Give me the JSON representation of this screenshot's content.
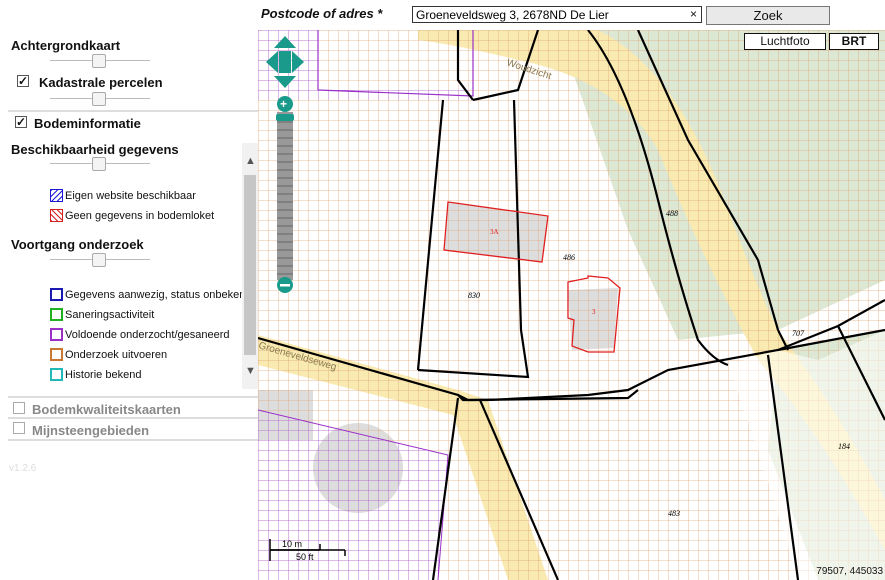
{
  "search": {
    "label": "Postcode of adres *",
    "value": "Groeneveldsweg 3, 2678ND De Lier",
    "clear_glyph": "×",
    "button_label": "Zoek"
  },
  "layers": {
    "luchtfoto": "Luchtfoto",
    "brt": "BRT"
  },
  "sidebar": {
    "achtergrondkaart": "Achtergrondkaart",
    "kadastrale": "Kadastrale percelen",
    "bodeminformatie": "Bodeminformatie",
    "beschikbaarheid": "Beschikbaarheid gegevens",
    "beschikbaarheid_items": [
      {
        "label": "Eigen website beschikbaar",
        "color": "#1a1ad6"
      },
      {
        "label": "Geen gegevens in bodemloket",
        "color": "#d62020"
      }
    ],
    "voortgang": "Voortgang onderzoek",
    "voortgang_items": [
      {
        "label": "Gegevens aanwezig, status onbekend",
        "color": "#1a1ab0"
      },
      {
        "label": "Saneringsactiviteit",
        "color": "#20b020"
      },
      {
        "label": "Voldoende onderzocht/gesaneerd",
        "color": "#9a30c8"
      },
      {
        "label": "Onderzoek uitvoeren",
        "color": "#c87830"
      },
      {
        "label": "Historie bekend",
        "color": "#20b8b8"
      }
    ],
    "bodemkwaliteit": "Bodemkwaliteitskaarten",
    "mijnsteen": "Mijnsteengebieden",
    "version": "v1.2.6"
  },
  "map": {
    "street_woudzicht": "Woudzicht",
    "street_groeneveldseweg": "Groeneveldseweg",
    "parcels": [
      "488",
      "486",
      "830",
      "707",
      "184",
      "483"
    ],
    "buildings": [
      "3A",
      "3"
    ],
    "scale_m": "10 m",
    "scale_ft": "50 ft",
    "coordinates": "79507, 445033"
  },
  "colors": {
    "grid": "#e0a070",
    "parcel_line": "#000000",
    "road": "#f8eab0",
    "green": "#dde8d4",
    "red_outline": "#e02020",
    "teal": "#1a9a8a"
  }
}
